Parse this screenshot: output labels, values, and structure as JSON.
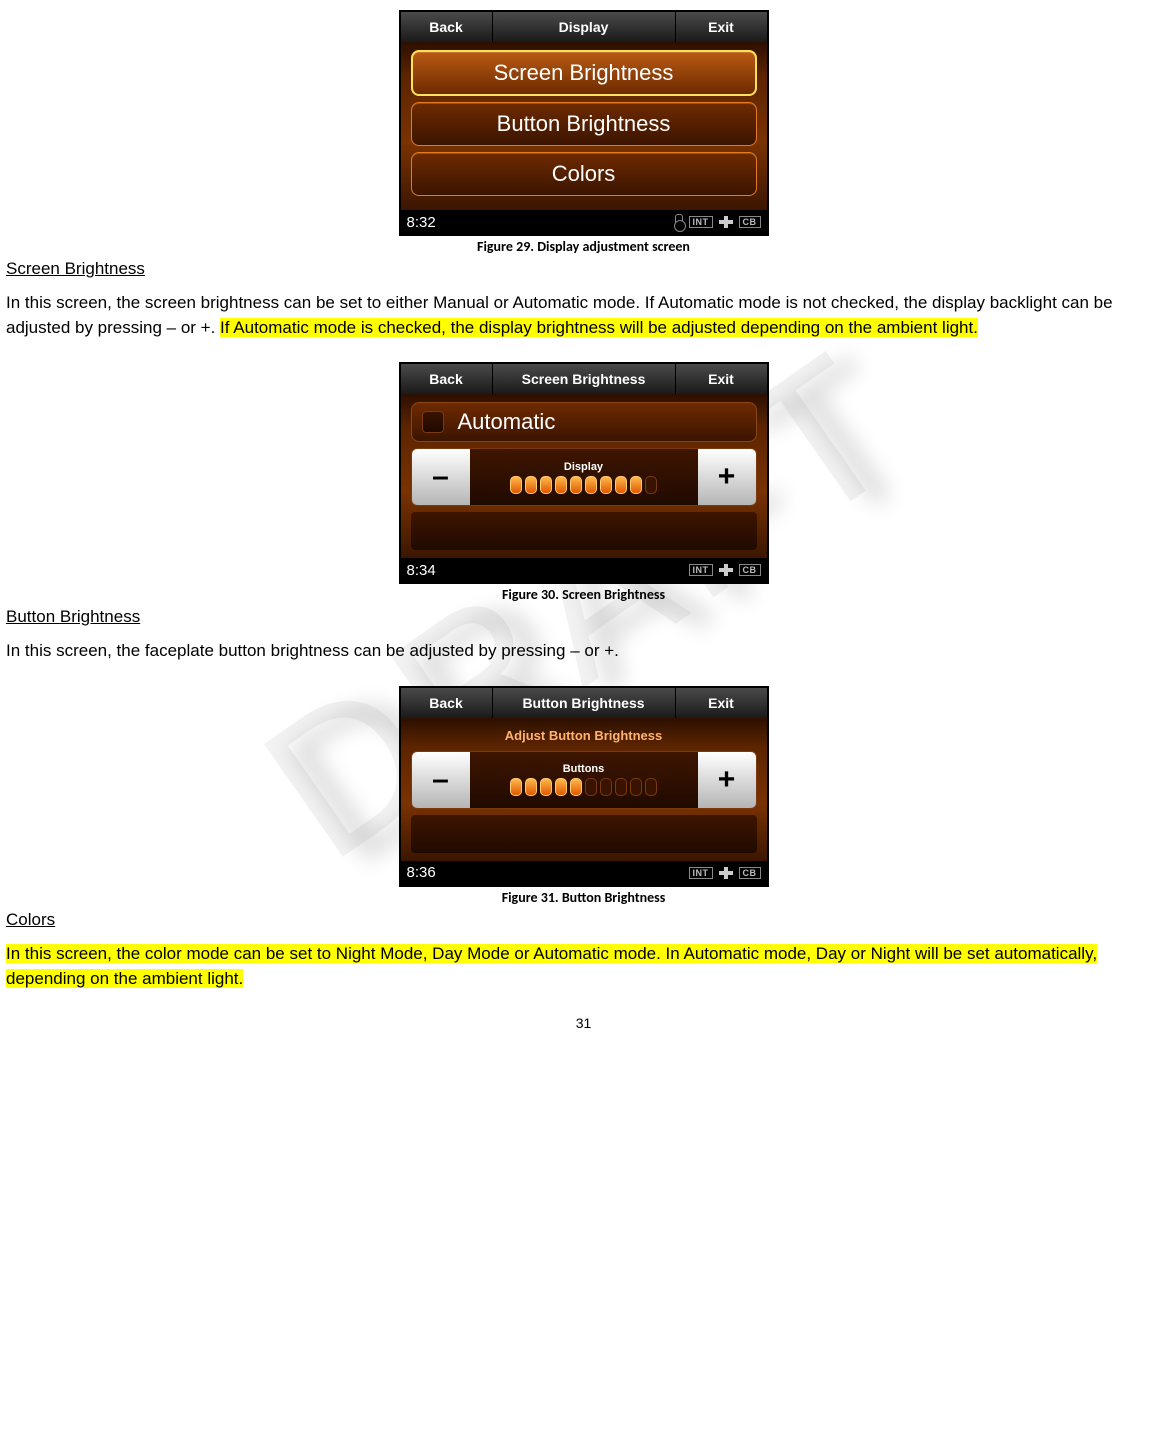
{
  "watermark": "DRAFT",
  "page_number": "31",
  "section1": {
    "heading": "Screen Brightness",
    "para_plain": "In this screen, the screen brightness can be set to either Manual or Automatic mode. If Automatic mode is not checked, the display backlight can be adjusted by pressing – or +. ",
    "para_hl": "If Automatic mode is checked, the display brightness will be adjusted depending on the ambient light."
  },
  "section2": {
    "heading": "Button Brightness",
    "para": "In this screen, the faceplate button brightness can be adjusted by pressing – or +."
  },
  "section3": {
    "heading": "Colors",
    "para_hl": "In this screen, the color mode can be set to Night Mode, Day Mode or Automatic mode. In Automatic mode, Day or Night will be set automatically, depending on the ambient light."
  },
  "fig29": {
    "caption": "Figure 29. Display adjustment screen",
    "topbar": {
      "back": "Back",
      "title": "Display",
      "exit": "Exit"
    },
    "menu": [
      "Screen Brightness",
      "Button Brightness",
      "Colors"
    ],
    "selected": 0,
    "clock": "8:32",
    "badges": [
      "INT",
      "CB"
    ]
  },
  "fig30": {
    "caption": "Figure 30. Screen Brightness",
    "topbar": {
      "back": "Back",
      "title": "Screen Brightness",
      "exit": "Exit"
    },
    "auto_label": "Automatic",
    "slider": {
      "label": "Display",
      "filled": 9,
      "total": 10,
      "minus": "–",
      "plus": "+"
    },
    "clock": "8:34",
    "badges": [
      "INT",
      "CB"
    ]
  },
  "fig31": {
    "caption": "Figure 31. Button Brightness",
    "topbar": {
      "back": "Back",
      "title": "Button Brightness",
      "exit": "Exit"
    },
    "header_text": "Adjust Button Brightness",
    "slider": {
      "label": "Buttons",
      "filled": 5,
      "total": 10,
      "minus": "–",
      "plus": "+"
    },
    "clock": "8:36",
    "badges": [
      "INT",
      "CB"
    ]
  }
}
